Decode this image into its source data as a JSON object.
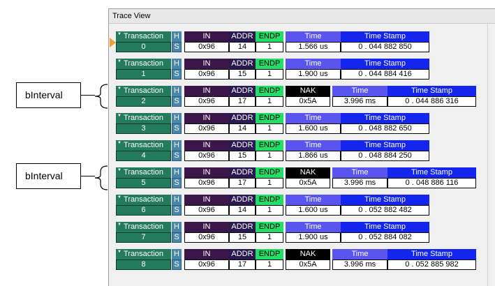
{
  "window": {
    "title": "Trace View"
  },
  "annotations": [
    {
      "text": "bInterval"
    },
    {
      "text": "bInterval"
    }
  ],
  "field_headers": {
    "transaction": "Transaction",
    "h": "H",
    "s": "S",
    "in": "IN",
    "addr": "ADDR",
    "endp": "ENDP",
    "nak": "NAK",
    "time": "Time",
    "timestamp": "Time Stamp"
  },
  "packets": [
    {
      "num": "0",
      "in": "0x96",
      "addr": "14",
      "endp": "1",
      "time": "1.566 us",
      "timestamp": "0 . 044 882 850"
    },
    {
      "num": "1",
      "in": "0x96",
      "addr": "15",
      "endp": "1",
      "time": "1.900 us",
      "timestamp": "0 . 044 884 416"
    },
    {
      "num": "2",
      "in": "0x96",
      "addr": "17",
      "endp": "1",
      "nak": "0x5A",
      "time": "3.996 ms",
      "timestamp": "0 . 044 886 316"
    },
    {
      "num": "3",
      "in": "0x96",
      "addr": "14",
      "endp": "1",
      "time": "1.600 us",
      "timestamp": "0 . 048 882 650"
    },
    {
      "num": "4",
      "in": "0x96",
      "addr": "15",
      "endp": "1",
      "time": "1.866 us",
      "timestamp": "0 . 048 884 250"
    },
    {
      "num": "5",
      "in": "0x96",
      "addr": "17",
      "endp": "1",
      "nak": "0x5A",
      "time": "3.996 ms",
      "timestamp": "0 . 048 886 116"
    },
    {
      "num": "6",
      "in": "0x96",
      "addr": "14",
      "endp": "1",
      "time": "1.600 us",
      "timestamp": "0 . 052 882 482"
    },
    {
      "num": "7",
      "in": "0x96",
      "addr": "15",
      "endp": "1",
      "time": "1.900 us",
      "timestamp": "0 . 052 884 082"
    },
    {
      "num": "8",
      "in": "0x96",
      "addr": "17",
      "endp": "1",
      "nak": "0x5A",
      "time": "3.996 ms",
      "timestamp": "0 . 052 885 982"
    }
  ]
}
